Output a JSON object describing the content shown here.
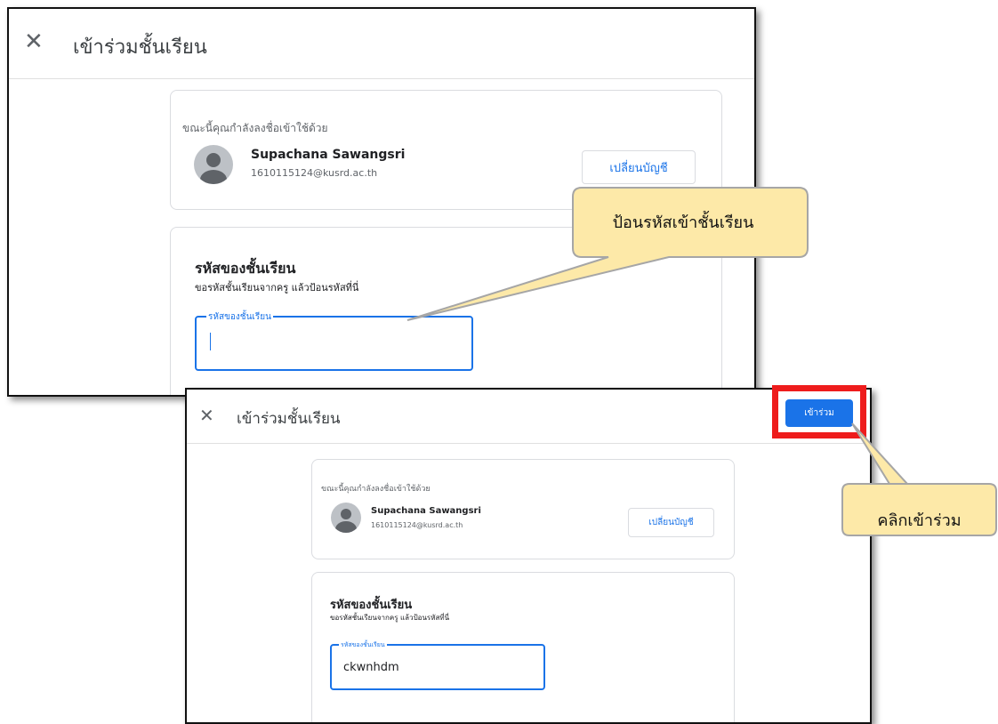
{
  "dialog": {
    "close_glyph": "✕",
    "title": "เข้าร่วมชั้นเรียน",
    "signed_in_label": "ขณะนี้คุณกำลังลงชื่อเข้าใช้ด้วย",
    "user_name": "Supachana Sawangsri",
    "user_email": "1610115124@kusrd.ac.th",
    "switch_account_label": "เปลี่ยนบัญชี",
    "code_heading": "รหัสของชั้นเรียน",
    "code_subtext": "ขอรหัสชั้นเรียนจากครู แล้วป้อนรหัสที่นี่",
    "code_field_label": "รหัสของชั้นเรียน"
  },
  "step1": {
    "code_value": ""
  },
  "step2": {
    "code_value": "ckwnhdm",
    "join_label": "เข้าร่วม"
  },
  "callouts": {
    "enter_code": "ป้อนรหัสเข้าชั้นเรียน",
    "click_join": "คลิกเข้าร่วม"
  },
  "colors": {
    "accent": "#1a73e8",
    "highlight": "#ee1c1c",
    "callout_fill": "#fde9a8",
    "callout_border": "#a6a6a6"
  }
}
